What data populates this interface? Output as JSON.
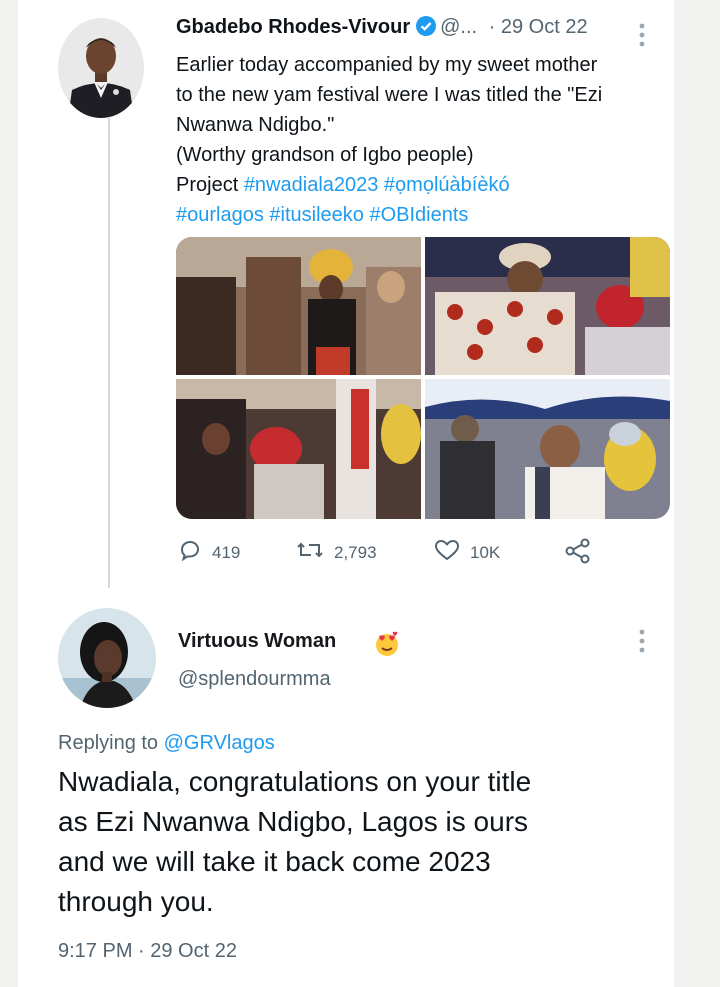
{
  "tweet": {
    "author_name": "Gbadebo Rhodes-Vivour",
    "author_handle": "@...",
    "date": "· 29 Oct 22",
    "lines": [
      "Earlier today accompanied by my sweet mother",
      "to the new yam festival were I was titled the \"Ezi",
      "Nwanwa Ndigbo.\"",
      "(Worthy grandson of Igbo people)"
    ],
    "project_label": "Project",
    "hashtags_line1": "#nwadiala2023 #ọmọlúàbíèkó",
    "hashtags_line2": "#ourlagos #itusileeko #OBIdients",
    "stats": {
      "replies": "419",
      "retweets": "2,793",
      "likes": "10K"
    }
  },
  "reply": {
    "author_name": "Virtuous Woman",
    "author_handle": "@splendourmma",
    "replying_label": "Replying to",
    "replying_handle": "@GRVlagos",
    "lines": [
      "Nwadiala, congratulations on your title",
      "as Ezi Nwanwa Ndigbo, Lagos is ours",
      "and we will take it back come 2023",
      "through you."
    ],
    "timestamp": "9:17 PM · 29 Oct 22"
  },
  "icons": [
    "verified-icon",
    "more-icon",
    "reply-icon",
    "retweet-icon",
    "like-icon",
    "share-icon",
    "heart-eyes-emoji"
  ],
  "colors": {
    "link": "#1d9bf0",
    "muted": "#536471",
    "text": "#0f1419",
    "thread_line": "#cfd9de"
  }
}
